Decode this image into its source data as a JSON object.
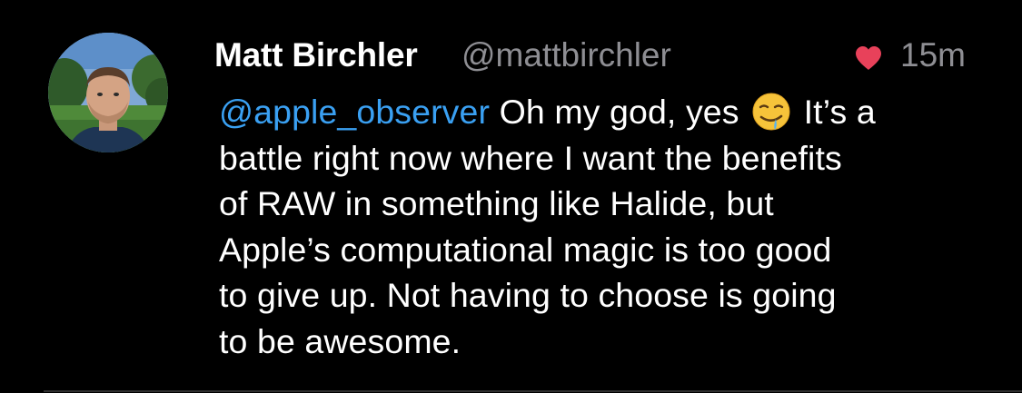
{
  "tweet": {
    "author": {
      "display_name": "Matt Birchler",
      "handle": "@mattbirchler",
      "avatar_icon": "profile-photo"
    },
    "like_icon": "heart-icon",
    "like_color": "#e8415a",
    "timestamp": "15m",
    "mention": "@apple_observer",
    "mention_color": "#3aa0f2",
    "line1_text": " Oh my god, yes ",
    "emoji": "drooling-face-emoji",
    "line1_tail": " It’s a",
    "lines": [
      "battle right now where I want the benefits",
      "of RAW in something like Halide, but",
      "Apple’s computational magic is too good",
      "to give up. Not having to choose is going",
      "to be awesome."
    ]
  }
}
